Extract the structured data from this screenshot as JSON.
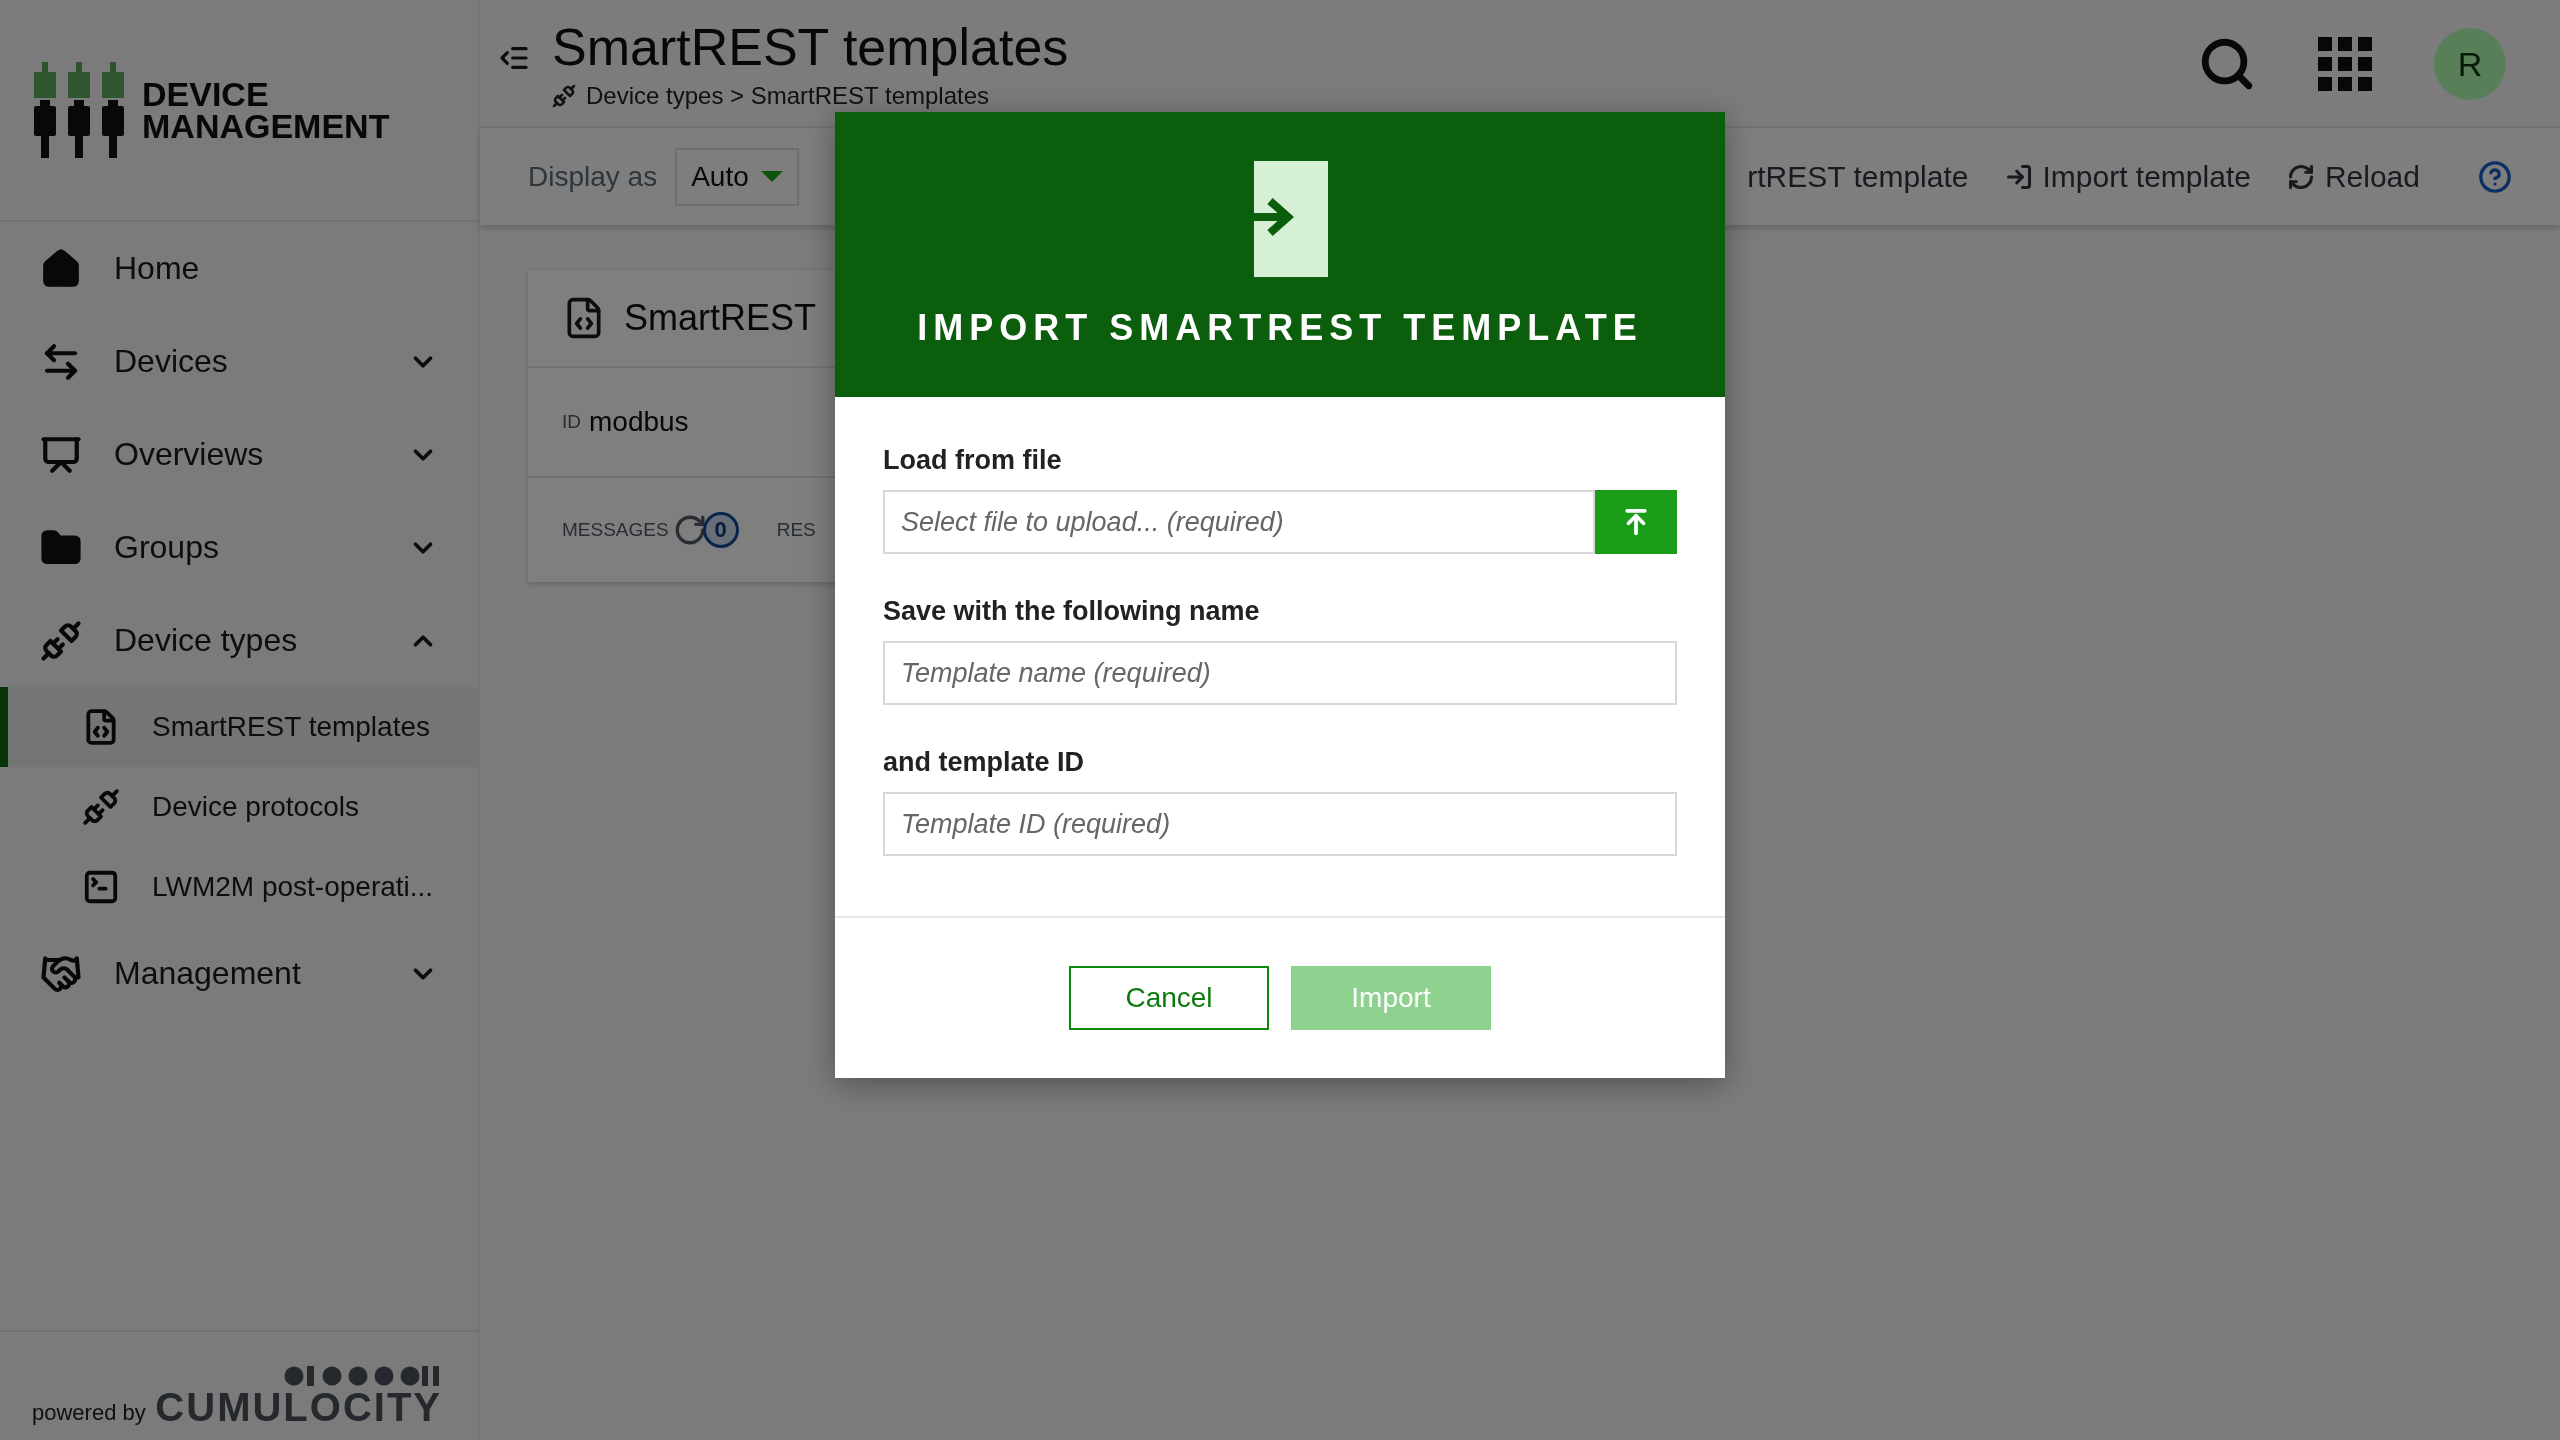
{
  "logo": {
    "lines": [
      "DEVICE",
      "MANAGEMENT"
    ]
  },
  "sidebar": {
    "items": [
      {
        "label": "Home",
        "kind": "link"
      },
      {
        "label": "Devices",
        "kind": "group",
        "expanded": false
      },
      {
        "label": "Overviews",
        "kind": "group",
        "expanded": false
      },
      {
        "label": "Groups",
        "kind": "group",
        "expanded": false
      },
      {
        "label": "Device types",
        "kind": "group",
        "expanded": true,
        "children": [
          {
            "label": "SmartREST templates",
            "selected": true
          },
          {
            "label": "Device protocols",
            "selected": false
          },
          {
            "label": "LWM2M post-operati...",
            "selected": false
          }
        ]
      },
      {
        "label": "Management",
        "kind": "group",
        "expanded": false
      }
    ]
  },
  "footer": {
    "powered_by": "powered by",
    "brand": "CUMULOCITY"
  },
  "header": {
    "title": "SmartREST templates",
    "breadcrumb": "Device types > SmartREST templates",
    "user_initial": "R"
  },
  "toolbar": {
    "display_label": "Display as",
    "display_value": "Auto",
    "actions": [
      {
        "label": "rtREST template",
        "kind": "add"
      },
      {
        "label": "Import template",
        "kind": "import"
      },
      {
        "label": "Reload",
        "kind": "reload"
      }
    ]
  },
  "card": {
    "title": "SmartREST",
    "id_label": "ID",
    "id_value": "modbus",
    "stats": [
      {
        "label": "MESSAGES",
        "count": "0"
      },
      {
        "label": "RES"
      }
    ]
  },
  "modal": {
    "title": "IMPORT SMARTREST TEMPLATE",
    "fields": [
      {
        "label": "Load from file",
        "placeholder": "Select file to upload... (required)",
        "kind": "file"
      },
      {
        "label": "Save with the following name",
        "placeholder": "Template name (required)",
        "kind": "text"
      },
      {
        "label": "and template ID",
        "placeholder": "Template ID (required)",
        "kind": "text"
      }
    ],
    "buttons": [
      {
        "label": "Cancel",
        "kind": "secondary",
        "disabled": false
      },
      {
        "label": "Import",
        "kind": "primary",
        "disabled": true
      }
    ]
  }
}
